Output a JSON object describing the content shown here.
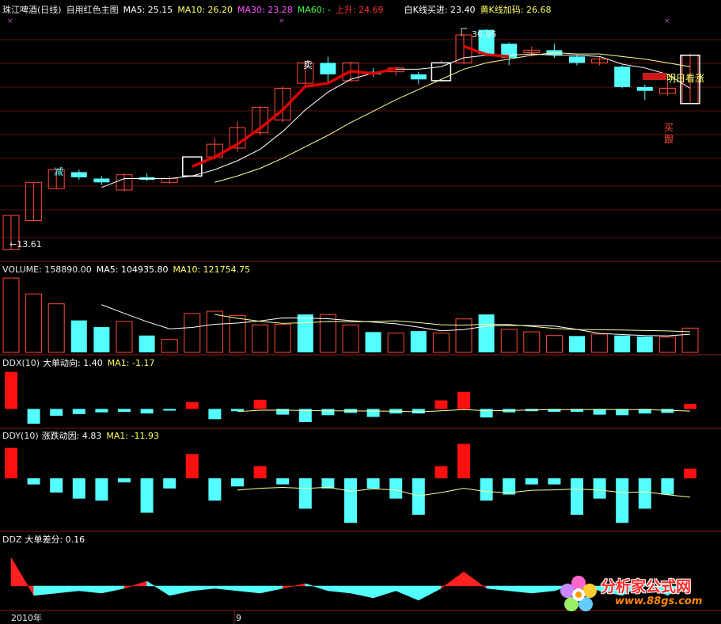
{
  "header": {
    "title": "珠江啤酒(日线)",
    "indicator_name": "自用红色主图",
    "ma5": "MA5: 25.15",
    "ma10": "MA10: 26.20",
    "ma30": "MA30: 23.28",
    "ma60": "MA60: -",
    "rise": "上升: 24.69",
    "white_k": "白K线买进: 23.40",
    "yellow_k": "黄K线加码: 26.68"
  },
  "annotations": {
    "high_label": "30.95",
    "low_label": "←13.61",
    "sell": "卖",
    "reduce": "减",
    "buy_follow": "买\n跟",
    "tomorrow": "明日看涨"
  },
  "panels": {
    "volume": {
      "label": "VOLUME: 158890.00",
      "ma5": "MA5: 104935.80",
      "ma10": "MA10: 121754.75"
    },
    "ddx": {
      "label": "DDX(10)",
      "name": "大单动向: 1.40",
      "ma": "MA1: -1.17"
    },
    "ddy": {
      "label": "DDY(10)",
      "name": "涨跌动因: 4.83",
      "ma": "MA1: -11.93"
    },
    "ddz": {
      "label": "DDZ",
      "name": "大单差分: 0.16"
    }
  },
  "axis": {
    "year": "2010年",
    "month": "9"
  },
  "watermark": {
    "text": "分析家公式网",
    "url": "www.88gs.com"
  },
  "colors": {
    "up": "#ff4a3a",
    "down": "#54ffff",
    "ma5": "#ffffff",
    "ma10": "#ffff99",
    "rise": "#e00000",
    "grid": "#8b1a1a",
    "ddx_up": "#ff1010"
  },
  "chart_data": [
    {
      "type": "candlestick",
      "title": "珠江啤酒(日线)",
      "ylim": [
        13.0,
        32.0
      ],
      "candles": [
        {
          "o": 13.6,
          "c": 16.3,
          "h": 16.3,
          "l": 13.6
        },
        {
          "o": 15.9,
          "c": 18.9,
          "h": 18.9,
          "l": 15.9
        },
        {
          "o": 18.4,
          "c": 19.9,
          "h": 19.9,
          "l": 18.4
        },
        {
          "o": 19.7,
          "c": 19.3,
          "h": 19.9,
          "l": 19.1
        },
        {
          "o": 19.2,
          "c": 18.9,
          "h": 19.4,
          "l": 18.7
        },
        {
          "o": 18.3,
          "c": 19.5,
          "h": 19.6,
          "l": 18.2
        },
        {
          "o": 19.3,
          "c": 19.1,
          "h": 19.6,
          "l": 19.0
        },
        {
          "o": 18.9,
          "c": 19.2,
          "h": 19.4,
          "l": 18.8
        },
        {
          "o": 19.4,
          "c": 20.9,
          "h": 20.9,
          "l": 19.3
        },
        {
          "o": 20.9,
          "c": 21.9,
          "h": 22.4,
          "l": 20.7
        },
        {
          "o": 21.6,
          "c": 23.2,
          "h": 23.7,
          "l": 21.3
        },
        {
          "o": 22.8,
          "c": 24.8,
          "h": 24.9,
          "l": 22.6
        },
        {
          "o": 23.8,
          "c": 26.3,
          "h": 26.4,
          "l": 23.6
        },
        {
          "o": 26.7,
          "c": 28.3,
          "h": 28.4,
          "l": 26.5
        },
        {
          "o": 28.3,
          "c": 27.4,
          "h": 28.8,
          "l": 26.7
        },
        {
          "o": 26.9,
          "c": 28.3,
          "h": 28.4,
          "l": 26.8
        },
        {
          "o": 27.6,
          "c": 27.4,
          "h": 27.9,
          "l": 27.2
        },
        {
          "o": 27.6,
          "c": 27.9,
          "h": 28.0,
          "l": 27.3
        },
        {
          "o": 27.4,
          "c": 27.0,
          "h": 27.6,
          "l": 26.6
        },
        {
          "o": 26.9,
          "c": 28.3,
          "h": 28.5,
          "l": 26.8
        },
        {
          "o": 28.3,
          "c": 30.5,
          "h": 30.6,
          "l": 28.2
        },
        {
          "o": 30.9,
          "c": 29.0,
          "h": 30.95,
          "l": 28.8
        },
        {
          "o": 29.8,
          "c": 28.7,
          "h": 29.9,
          "l": 28.1
        },
        {
          "o": 29.1,
          "c": 29.3,
          "h": 29.6,
          "l": 28.8
        },
        {
          "o": 29.3,
          "c": 28.9,
          "h": 29.8,
          "l": 28.7
        },
        {
          "o": 28.8,
          "c": 28.3,
          "h": 28.9,
          "l": 28.1
        },
        {
          "o": 28.3,
          "c": 28.6,
          "h": 28.8,
          "l": 28.1
        },
        {
          "o": 28.0,
          "c": 26.4,
          "h": 28.1,
          "l": 26.3
        },
        {
          "o": 26.4,
          "c": 26.1,
          "h": 26.6,
          "l": 25.4
        },
        {
          "o": 25.9,
          "c": 26.3,
          "h": 26.8,
          "l": 25.7
        },
        {
          "o": 25.1,
          "c": 28.9,
          "h": 29.0,
          "l": 25.1
        }
      ],
      "ma5": [
        null,
        null,
        null,
        null,
        18.5,
        19.2,
        19.2,
        19.2,
        19.4,
        19.9,
        20.6,
        21.5,
        22.9,
        24.6,
        26.0,
        27.0,
        27.5,
        27.8,
        27.8,
        28.0,
        28.7,
        28.9,
        28.9,
        29.0,
        28.9,
        28.9,
        28.8,
        28.2,
        27.9,
        27.4,
        26.3
      ],
      "ma10": [
        null,
        null,
        null,
        null,
        null,
        null,
        null,
        null,
        null,
        18.9,
        19.4,
        20.0,
        20.8,
        21.7,
        22.6,
        23.6,
        24.5,
        25.4,
        26.2,
        27.0,
        27.8,
        28.3,
        28.6,
        28.9,
        29.1,
        29.0,
        29.0,
        28.8,
        28.6,
        28.3,
        28.0
      ],
      "rise_segments": [
        [
          8,
          9,
          10,
          11,
          12,
          13,
          14,
          15,
          16,
          17
        ],
        [
          20,
          21,
          22
        ]
      ]
    },
    {
      "type": "bar",
      "title": "VOLUME",
      "values": [
        300000,
        236000,
        196000,
        129000,
        102000,
        125000,
        68000,
        52000,
        157000,
        166000,
        149000,
        111000,
        113000,
        153000,
        153000,
        111000,
        82000,
        78000,
        86000,
        78000,
        135000,
        153000,
        93000,
        83000,
        68000,
        66000,
        74000,
        68000,
        64000,
        62000,
        98000
      ],
      "up": [
        1,
        1,
        1,
        0,
        0,
        1,
        0,
        1,
        1,
        1,
        1,
        1,
        1,
        0,
        1,
        1,
        0,
        1,
        0,
        1,
        1,
        0,
        1,
        1,
        1,
        0,
        1,
        0,
        0,
        1,
        1
      ],
      "ylim": [
        0,
        310000
      ]
    },
    {
      "type": "bar",
      "title": "DDX",
      "values": [
        6.5,
        -2.6,
        -1.2,
        -0.9,
        -0.6,
        -0.5,
        -0.8,
        -0.3,
        1.2,
        -1.8,
        -0.4,
        1.6,
        -1.0,
        -2.3,
        -1.1,
        -0.7,
        -1.4,
        -0.8,
        -0.8,
        1.5,
        3.0,
        -1.5,
        -0.6,
        -0.4,
        -0.5,
        -0.5,
        -1.0,
        -1.1,
        -0.8,
        -0.7,
        0.9
      ],
      "ylim": [
        -3,
        7
      ]
    },
    {
      "type": "bar",
      "title": "DDY",
      "values": [
        15,
        -3,
        -7,
        -10,
        -11,
        -2,
        -17,
        -5,
        12,
        -11,
        -4,
        6,
        -3,
        -15,
        -5,
        -22,
        -5,
        -10,
        -18,
        6,
        17,
        -11,
        -8,
        -3,
        -3,
        -18,
        -10,
        -22,
        -15,
        -8,
        4.8
      ],
      "ylim": [
        -25,
        18
      ]
    },
    {
      "type": "area",
      "title": "DDZ",
      "values": [
        1.2,
        -0.4,
        -0.3,
        -0.2,
        -0.3,
        -0.1,
        0.2,
        -0.4,
        -0.2,
        -0.1,
        -0.2,
        -0.3,
        -0.1,
        0.1,
        -0.2,
        -0.3,
        -0.5,
        -0.2,
        -0.6,
        -0.1,
        0.6,
        -0.1,
        -0.2,
        -0.3,
        -0.2,
        0.1,
        -0.2,
        -0.4,
        0.1,
        -0.4,
        0.16
      ],
      "ylim": [
        -1,
        1.5
      ]
    }
  ]
}
